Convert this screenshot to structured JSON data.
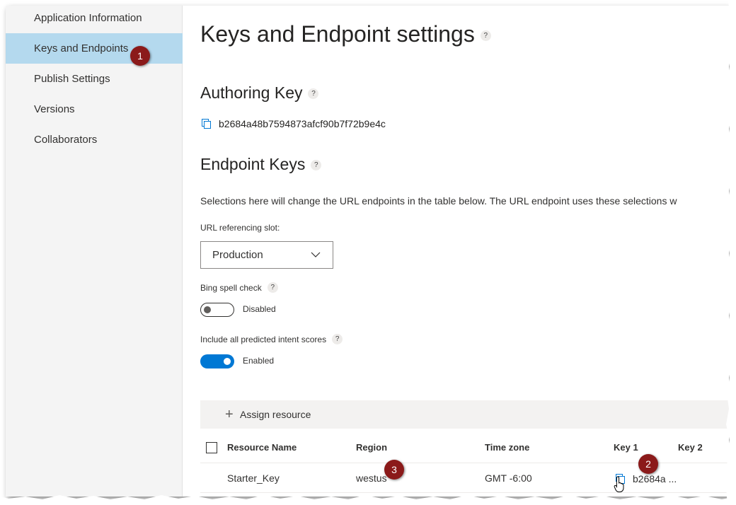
{
  "sidebar": {
    "items": [
      {
        "label": "Application Information"
      },
      {
        "label": "Keys and Endpoints",
        "active": true
      },
      {
        "label": "Publish Settings"
      },
      {
        "label": "Versions"
      },
      {
        "label": "Collaborators"
      }
    ]
  },
  "main": {
    "title": "Keys and Endpoint settings",
    "help_glyph": "?",
    "authoring": {
      "heading": "Authoring Key",
      "key": "b2684a48b7594873afcf90b7f72b9e4c"
    },
    "endpoint": {
      "heading": "Endpoint Keys",
      "description": "Selections here will change the URL endpoints in the table below. The URL endpoint uses these selections w",
      "slot_label": "URL referencing slot:",
      "slot_value": "Production",
      "spell_label": "Bing spell check",
      "spell_state": "Disabled",
      "spell_enabled": false,
      "intent_label": "Include all predicted intent scores",
      "intent_state": "Enabled",
      "intent_enabled": true
    },
    "command_bar": {
      "assign_label": "Assign resource"
    },
    "table": {
      "headers": [
        "Resource Name",
        "Region",
        "Time zone",
        "Key 1",
        "Key 2"
      ],
      "rows": [
        {
          "resource_name": "Starter_Key",
          "region": "westus",
          "time_zone": "GMT -6:00",
          "key1": "b2684a ...",
          "key2": ""
        }
      ]
    }
  },
  "annotations": {
    "badge1": "1",
    "badge2": "2",
    "badge3": "3",
    "color": "#8b1a1a"
  },
  "colors": {
    "accent": "#0078d4",
    "active_nav": "#b4d9ee"
  }
}
